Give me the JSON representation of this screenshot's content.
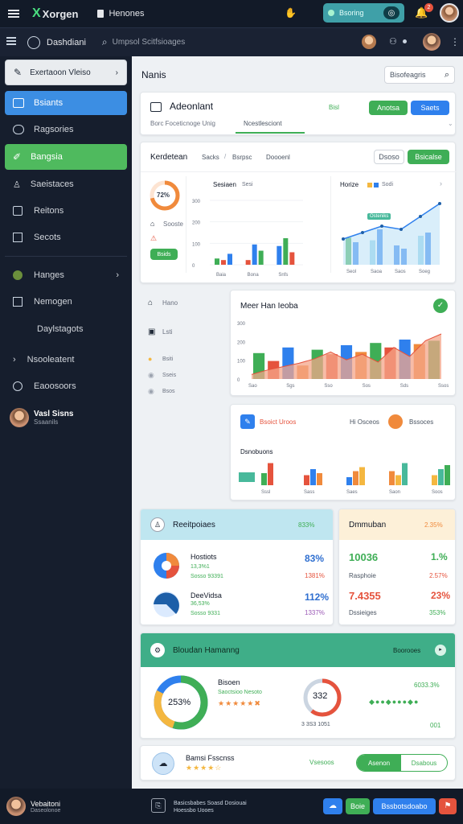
{
  "app": {
    "brand": "Xorgen",
    "window_title": "Henones",
    "notif_count": "2"
  },
  "top": {
    "toggle_label": "Bsoring"
  },
  "sub": {
    "title": "Dashdiani",
    "search_placeholder": "Umpsol Scitfsioages"
  },
  "sidebar": {
    "header": "Exertaoon Vleiso",
    "items": [
      {
        "label": "Bsiants"
      },
      {
        "label": "Ragsories"
      },
      {
        "label": "Bangsia"
      },
      {
        "label": "Saeistaces"
      },
      {
        "label": "Reitons"
      },
      {
        "label": "Secots"
      },
      {
        "label": "Hanges"
      },
      {
        "label": "Nemogen"
      },
      {
        "label": "Daylstagots"
      },
      {
        "label": "Nsooleatent"
      },
      {
        "label": "Eaoosoors"
      }
    ],
    "user": {
      "name": "Vasl Sisns",
      "role": "Ssaanils"
    }
  },
  "page": {
    "title": "Nanis",
    "filter_label": "Bisofeagris"
  },
  "overview": {
    "title": "Adeonlant",
    "tabs": [
      "Borc Foceticnoge Unig",
      "Ncestlesciont"
    ],
    "status": "Bisl",
    "btn_primary": "Anotsa",
    "btn_secondary": "Saets"
  },
  "stats_panel": {
    "title": "Kerdetean",
    "breadcrumb": [
      "Sacks",
      "Bsrpsc",
      "Doooenl"
    ],
    "btn_outline": "Dsoso",
    "btn_primary": "Bsicalse",
    "gauge_value": "72%",
    "gauge_text": "Sooste",
    "mini_btn": "Bsids",
    "chart_left_title": "Sesiaen",
    "chart_left_legend": "Sesi",
    "chart_right_title": "Horize",
    "chart_right_legend": "Sodi",
    "right_callout": "Osteniks"
  },
  "chart_data": [
    {
      "type": "bar",
      "title": "Sesiaen",
      "categories": [
        "Baia",
        "Bona",
        "Snfs"
      ],
      "yticks": [
        "0",
        "100",
        "200",
        "300"
      ],
      "series": [
        {
          "name": "Sesi",
          "values": [
            20,
            15,
            60
          ]
        },
        {
          "values": [
            15,
            65,
            85
          ]
        },
        {
          "values": [
            35,
            45,
            40
          ]
        }
      ],
      "ylim": [
        0,
        330
      ]
    },
    {
      "type": "bar",
      "title": "Horize",
      "categories": [
        "Seol",
        "Saoa",
        "Saos",
        "Soeg"
      ],
      "series": [
        {
          "name": "Sodi",
          "values": [
            42,
            38,
            30,
            45
          ]
        },
        {
          "values": [
            35,
            55,
            25,
            50
          ]
        }
      ],
      "line": [
        40,
        50,
        60,
        55,
        75,
        95
      ],
      "ylim": [
        0,
        100
      ]
    },
    {
      "type": "area",
      "title": "Meer Han Ieoba",
      "categories": [
        "Sao",
        "Sgs",
        "Sso",
        "Sos",
        "Sds",
        "Ssos"
      ],
      "yticks": [
        "0",
        "100",
        "200",
        "300"
      ],
      "bars": [
        115,
        80,
        140,
        60,
        130,
        110,
        150,
        120,
        160,
        140,
        175,
        155,
        170
      ],
      "area": [
        20,
        40,
        55,
        70,
        90,
        120,
        85,
        110,
        75,
        140,
        100,
        170,
        200
      ],
      "ylim": [
        0,
        300
      ]
    },
    {
      "type": "bar",
      "title": "Dsnobuons",
      "categories": [
        "Sssl",
        "Sass",
        "Saes",
        "Saon",
        "Soos"
      ],
      "groups": [
        [
          30,
          55
        ],
        [
          25,
          40,
          30
        ],
        [
          20,
          35,
          45
        ],
        [
          35,
          25,
          55
        ],
        [
          25,
          40,
          50
        ]
      ]
    }
  ],
  "left_list": [
    {
      "label": "Hano"
    },
    {
      "label": "Lsti"
    },
    {
      "label": "Bsiti"
    },
    {
      "label": "Sseis"
    },
    {
      "label": "Bsos"
    }
  ],
  "mixed": {
    "title": "Meer Han Ieoba"
  },
  "report": {
    "left": "Bsoict Uroos",
    "center": "Hi Osceos",
    "right": "Bssoces",
    "sub_title": "Dsnobuons"
  },
  "kpi_a": {
    "title": "Reeitpoiaes",
    "headline": "833%",
    "rows": [
      {
        "name": "Hostiots",
        "sub": "13,3%1",
        "detail": "Sosso 93391",
        "pct": "83%",
        "pct2": "1381%"
      },
      {
        "name": "DeeVidsa",
        "sub": "36,53%",
        "detail": "Sosso 9331",
        "pct": "112%",
        "pct2": "1337%"
      }
    ]
  },
  "kpi_b": {
    "title": "Dmmuban",
    "headline": "2.35%",
    "rows": [
      {
        "value": "10036",
        "sub": "Rasphoie",
        "pct": "1.%",
        "pct2": "2.57%"
      },
      {
        "value": "7.4355",
        "sub": "Dssieiges",
        "pct": "23%",
        "pct2": "353%"
      }
    ]
  },
  "donut_card": {
    "title": "Bloudan Hamanng",
    "action": "Boorooes",
    "donut_value": "253%",
    "label1": "Bisoen",
    "label2": "Saoctsioo Nesoto",
    "ring_value": "332",
    "ring_caption": "3 3S3 1051",
    "right_pct": "6033.3%",
    "right_value": "001"
  },
  "rating_card": {
    "title": "Bamsi Fsscnss",
    "link": "Vsesoos",
    "toggle_a": "Asenon",
    "toggle_b": "Dsabous"
  },
  "footer": {
    "user_name": "Vebaitoni",
    "user_role": "Daseolonoe",
    "message": "Basicsbabes Soasd Dosiouai Hoessbo Uooes",
    "btn_a": "Boie",
    "btn_b": "Bssbotsdoabo"
  },
  "colors": {
    "green": "#3fae56",
    "blue": "#2f80ed",
    "orange": "#f08a3c",
    "red": "#e5533d",
    "teal": "#48b99b",
    "sidebar": "#161e2d",
    "topbar": "#121a28"
  }
}
